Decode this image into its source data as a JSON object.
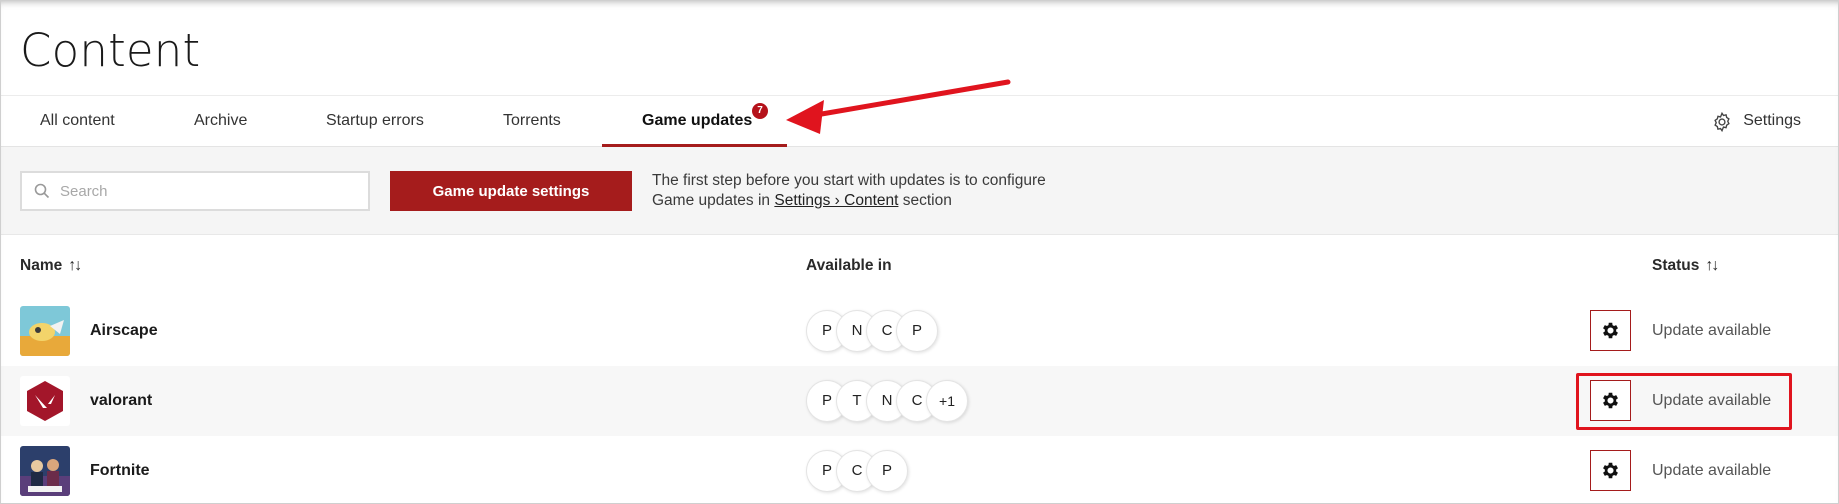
{
  "page": {
    "title": "Content"
  },
  "tabs": [
    {
      "label": "All content"
    },
    {
      "label": "Archive"
    },
    {
      "label": "Startup errors"
    },
    {
      "label": "Torrents"
    },
    {
      "label": "Game updates",
      "active": true,
      "badge": "7"
    }
  ],
  "settings_link": {
    "label": "Settings",
    "icon": "gear-icon"
  },
  "toolbar": {
    "search_placeholder": "Search",
    "update_settings_button": "Game update settings",
    "hint_prefix": "The first step before you start with updates is to configure Game updates in ",
    "hint_link": "Settings › Content",
    "hint_suffix": " section"
  },
  "table": {
    "columns": {
      "name": "Name",
      "available_in": "Available in",
      "status": "Status"
    },
    "rows": [
      {
        "name": "Airscape",
        "thumb": "airscape-thumbnail",
        "chips": [
          "P",
          "N",
          "C",
          "P"
        ],
        "status": "Update available"
      },
      {
        "name": "valorant",
        "thumb": "valorant-logo",
        "chips": [
          "P",
          "T",
          "N",
          "C",
          "+1"
        ],
        "status": "Update available"
      },
      {
        "name": "Fortnite",
        "thumb": "fortnite-thumbnail",
        "chips": [
          "P",
          "C",
          "P"
        ],
        "status": "Update available"
      }
    ]
  },
  "colors": {
    "accent": "#a51c1c",
    "badge": "#b5121b",
    "annotation": "#e0141e"
  }
}
